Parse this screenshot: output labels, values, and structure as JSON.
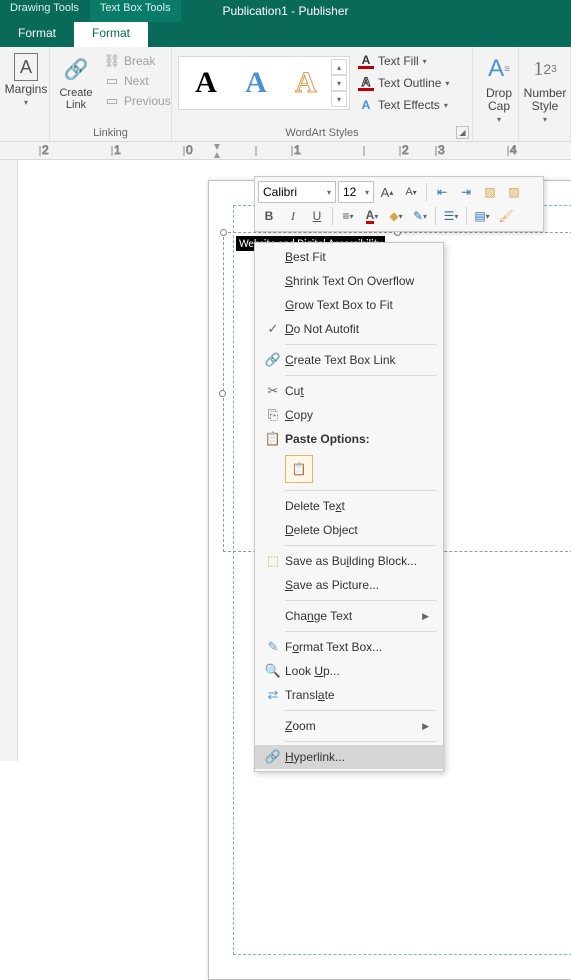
{
  "titlebar": {
    "title": "Publication1 - Publisher"
  },
  "tooltabs": {
    "drawing": "Drawing Tools",
    "textbox": "Text Box Tools"
  },
  "ribbontabs": {
    "format1": "Format",
    "format2": "Format"
  },
  "margins": {
    "label": "Margins"
  },
  "createlink": {
    "label": "Create\nLink"
  },
  "linking": {
    "break": "Break",
    "next": "Next",
    "previous": "Previous",
    "group": "Linking"
  },
  "wordart": {
    "sample": "A",
    "group": "WordArt Styles",
    "fill": "Text Fill",
    "outline": "Text Outline",
    "effects": "Text Effects"
  },
  "dropcap": {
    "label": "Drop\nCap"
  },
  "numstyle": {
    "label": "Number\nStyle"
  },
  "minitoolbar": {
    "font": "Calibri",
    "size": "12"
  },
  "selected_text": "Website and Digital Accessibility",
  "context_menu": {
    "best_fit": "Best Fit",
    "shrink": "Shrink Text On Overflow",
    "grow": "Grow Text Box to Fit",
    "noautofit": "Do Not Autofit",
    "createlink": "Create Text Box Link",
    "cut": "Cut",
    "copy": "Copy",
    "paste_options": "Paste Options:",
    "delete_text": "Delete Text",
    "delete_object": "Delete Object",
    "save_block": "Save as Building Block...",
    "save_pic": "Save as Picture...",
    "change_text": "Change Text",
    "format_box": "Format Text Box...",
    "lookup": "Look Up...",
    "translate": "Translate",
    "zoom": "Zoom",
    "hyperlink": "Hyperlink..."
  }
}
